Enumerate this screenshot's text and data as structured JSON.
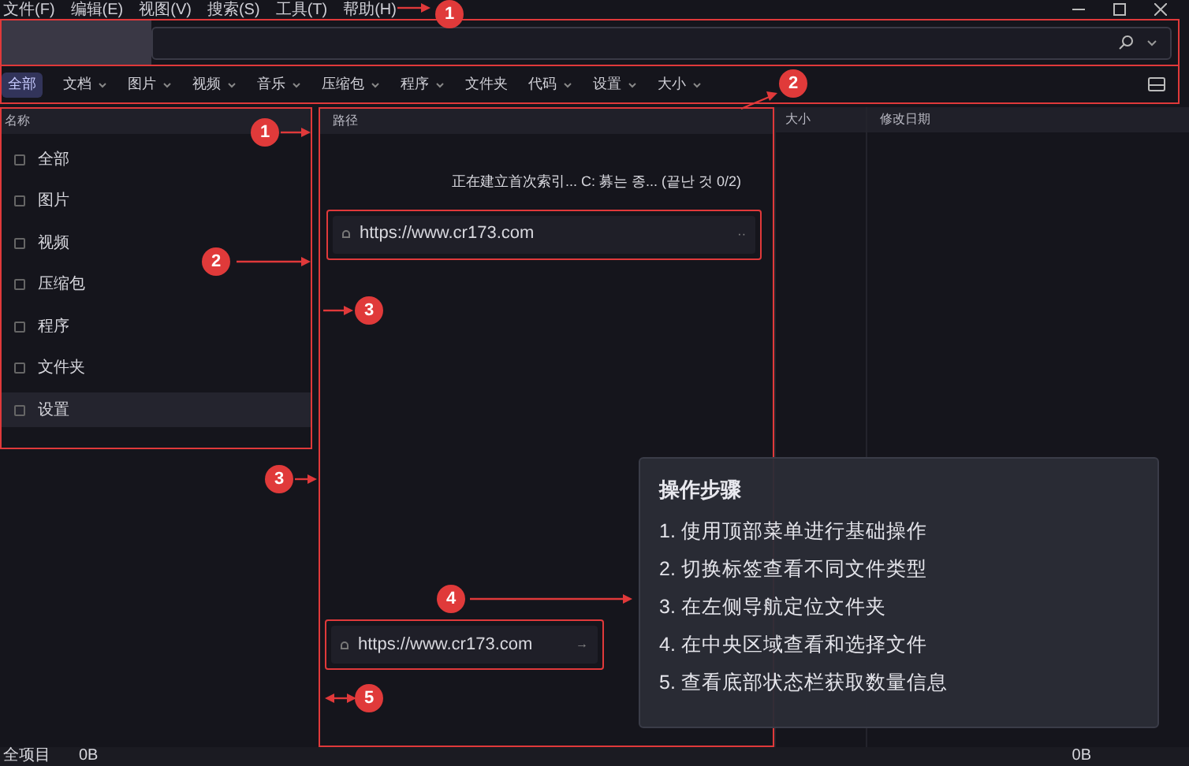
{
  "menu": [
    "文件(F)",
    "编辑(E)",
    "视图(V)",
    "搜索(S)",
    "工具(T)",
    "帮助(H)"
  ],
  "filter_tabs": [
    {
      "label": "全部",
      "selected": true,
      "dropdown": false
    },
    {
      "label": "文档",
      "selected": false,
      "dropdown": true
    },
    {
      "label": "图片",
      "selected": false,
      "dropdown": true
    },
    {
      "label": "视频",
      "selected": false,
      "dropdown": true
    },
    {
      "label": "音乐",
      "selected": false,
      "dropdown": true
    },
    {
      "label": "压缩包",
      "selected": false,
      "dropdown": true
    },
    {
      "label": "程序",
      "selected": false,
      "dropdown": true
    },
    {
      "label": "文件夹",
      "selected": false,
      "dropdown": false
    },
    {
      "label": "代码",
      "selected": false,
      "dropdown": true
    },
    {
      "label": "设置",
      "selected": false,
      "dropdown": true
    },
    {
      "label": "大小",
      "selected": false,
      "dropdown": true
    }
  ],
  "sidebar": {
    "header": "名称",
    "items": [
      {
        "label": "全部",
        "selected": false
      },
      {
        "label": "图片",
        "selected": false
      },
      {
        "label": "视频",
        "selected": false
      },
      {
        "label": "压缩包",
        "selected": false
      },
      {
        "label": "程序",
        "selected": false
      },
      {
        "label": "文件夹",
        "selected": false
      },
      {
        "label": "设置",
        "selected": true
      }
    ]
  },
  "columns": [
    "路径",
    "大小",
    "修改日期"
  ],
  "indexing_status": "正在建立首次索引... C: 募는 종... (끝난 것 0/2)",
  "url_fields": [
    {
      "value": "https://www.cr173.com",
      "trailing": "··"
    },
    {
      "value": "https://www.cr173.com",
      "trailing": "→"
    }
  ],
  "annotations": [
    "1",
    "2",
    "1",
    "2",
    "3",
    "3",
    "4",
    "5"
  ],
  "steps_card": {
    "title": "操作步骤",
    "steps": [
      "1. 使用顶部菜单进行基础操作",
      "2. 切换标签查看不同文件类型",
      "3. 在左侧导航定位文件夹",
      "4. 在中央区域查看和选择文件",
      "5. 查看底部状态栏获取数量信息"
    ]
  },
  "status_bar": {
    "left": [
      "全项目",
      "0B"
    ],
    "right": "0B"
  }
}
